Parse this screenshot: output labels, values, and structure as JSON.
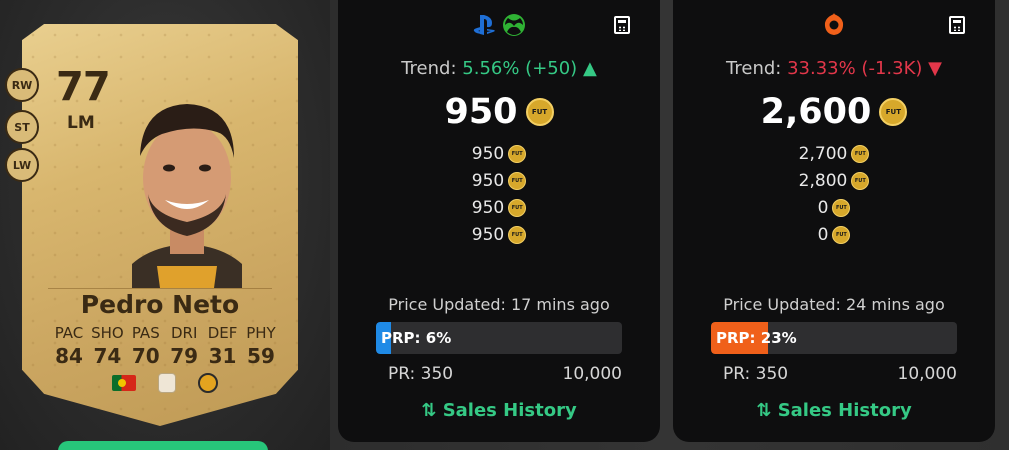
{
  "card": {
    "rating": "77",
    "position": "LM",
    "alt_positions": [
      "RW",
      "ST",
      "LW"
    ],
    "name": "Pedro Neto",
    "stat_labels": [
      "PAC",
      "SHO",
      "PAS",
      "DRI",
      "DEF",
      "PHY"
    ],
    "stat_values": [
      "84",
      "74",
      "70",
      "79",
      "31",
      "59"
    ]
  },
  "console_panel": {
    "platforms": [
      "playstation-icon",
      "xbox-icon"
    ],
    "trend_label": "Trend:",
    "trend_value": "5.56% (+50)",
    "trend_direction": "up",
    "main_price": "950",
    "other_prices": [
      "950",
      "950",
      "950",
      "950"
    ],
    "updated": "Price Updated: 17 mins ago",
    "prp_label": "PRP: 6%",
    "prp_percent": 6,
    "pr_min": "PR: 350",
    "pr_max": "10,000",
    "sales_history": "Sales History",
    "color": "#1f8ae6"
  },
  "pc_panel": {
    "platforms": [
      "origin-icon"
    ],
    "trend_label": "Trend:",
    "trend_value": "33.33% (-1.3K)",
    "trend_direction": "down",
    "main_price": "2,600",
    "other_prices": [
      "2,700",
      "2,800",
      "0",
      "0"
    ],
    "updated": "Price Updated: 24 mins ago",
    "prp_label": "PRP: 23%",
    "prp_percent": 23,
    "pr_min": "PR: 350",
    "pr_max": "10,000",
    "sales_history": "Sales History",
    "color": "#f0601a"
  },
  "coin_label": "FUT"
}
